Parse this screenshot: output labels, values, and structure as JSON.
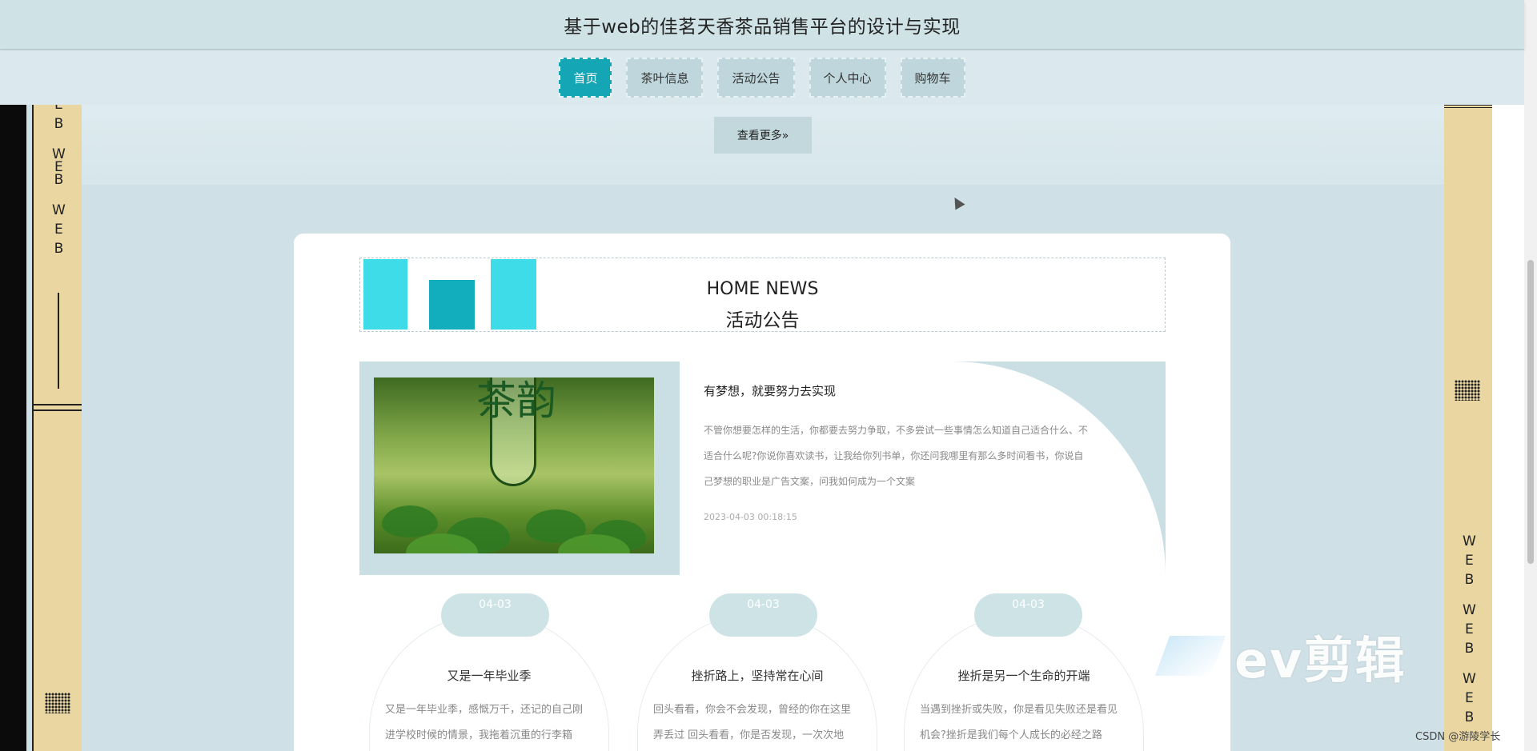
{
  "header": {
    "title": "基于web的佳茗天香茶品销售平台的设计与实现"
  },
  "nav": {
    "items": [
      {
        "label": "首页",
        "active": true
      },
      {
        "label": "茶叶信息",
        "active": false
      },
      {
        "label": "活动公告",
        "active": false
      },
      {
        "label": "个人中心",
        "active": false
      },
      {
        "label": "购物车",
        "active": false
      }
    ]
  },
  "band": {
    "more_label": "查看更多»"
  },
  "news": {
    "title_en": "HOME NEWS",
    "title_cn": "活动公告",
    "featured": {
      "title": "有梦想，就要努力去实现",
      "body": "不管你想要怎样的生活，你都要去努力争取，不多尝试一些事情怎么知道自己适合什么、不适合什么呢?你说你喜欢读书，让我给你列书单，你还问我哪里有那么多时间看书，你说自己梦想的职业是广告文案，问我如何成为一个文案",
      "date": "2023-04-03 00:18:15",
      "image_caption": "茶韵"
    },
    "items": [
      {
        "date": "04-03",
        "title": "又是一年毕业季",
        "body": "又是一年毕业季，感慨万千，还记的自己刚进学校时候的情景，我拖着沉重的行李箱"
      },
      {
        "date": "04-03",
        "title": "挫折路上，坚持常在心间",
        "body": "回头看看，你会不会发现，曾经的你在这里弄丢过 回头看看，你是否发现，一次次地重"
      },
      {
        "date": "04-03",
        "title": "挫折是另一个生命的开端",
        "body": "当遇到挫折或失败，你是看见失败还是看见机会?挫折是我们每个人成长的必经之路"
      }
    ]
  },
  "sidebars": {
    "left_text": [
      "E",
      "B",
      "W",
      "E",
      "B",
      "W",
      "E",
      "B"
    ],
    "right_text": [
      "W",
      "E",
      "B",
      "W",
      "E",
      "B",
      "W",
      "E",
      "B"
    ]
  },
  "overlay": {
    "watermark": "ev剪辑",
    "credit": "CSDN @游陵学长"
  }
}
